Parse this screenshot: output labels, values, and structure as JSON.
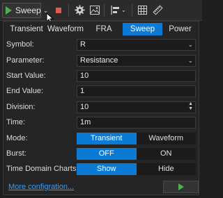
{
  "toolbar": {
    "run_label": "Sweep",
    "icons": [
      "play-icon",
      "chevron-down-icon",
      "stop-icon",
      "gear-icon",
      "image-icon",
      "align-icon",
      "grid-icon",
      "ruler-icon"
    ]
  },
  "colors": {
    "accent": "#0a7ad4",
    "background": "#1e1e1e",
    "panel": "#252526",
    "link": "#3f9bf0",
    "play": "#4caf50",
    "stop": "#e05a4f"
  },
  "tabs": [
    "Transient",
    "Waveform",
    "FRA",
    "Sweep",
    "Power"
  ],
  "active_tab": "Sweep",
  "form": {
    "symbol": {
      "label": "Symbol:",
      "value": "R"
    },
    "parameter": {
      "label": "Parameter:",
      "value": "Resistance"
    },
    "start": {
      "label": "Start Value:",
      "value": "10"
    },
    "end": {
      "label": "End Value:",
      "value": "1"
    },
    "division": {
      "label": "Division:",
      "value": "10"
    },
    "time": {
      "label": "Time:",
      "value": "1m"
    },
    "mode": {
      "label": "Mode:",
      "options": [
        "Transient",
        "Waveform"
      ],
      "selected": "Transient"
    },
    "burst": {
      "label": "Burst:",
      "options": [
        "OFF",
        "ON"
      ],
      "selected": "OFF"
    },
    "charts": {
      "label": "Time Domain Charts:",
      "options": [
        "Show",
        "Hide"
      ],
      "selected": "Show"
    }
  },
  "footer": {
    "link": "More configration..."
  }
}
